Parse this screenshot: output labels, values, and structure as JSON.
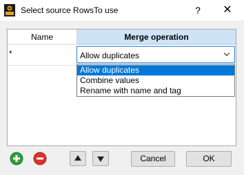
{
  "window": {
    "title": "Select source RowsTo use",
    "help_label": "?",
    "close_label": "✕"
  },
  "table": {
    "columns": [
      "Name",
      "Merge operation"
    ],
    "rows": [
      {
        "marker": "*",
        "merge_operation": "Allow duplicates"
      }
    ]
  },
  "dropdown": {
    "selected": "Allow duplicates",
    "options": [
      "Allow duplicates",
      "Combine values",
      "Rename with name and tag"
    ]
  },
  "toolbar": {
    "add_icon": "plus-circle-icon",
    "remove_icon": "minus-circle-icon",
    "up_icon": "triangle-up-icon",
    "down_icon": "triangle-down-icon"
  },
  "buttons": {
    "cancel": "Cancel",
    "ok": "OK"
  },
  "colors": {
    "header_selected": "#cde4f7",
    "selection": "#0078d7",
    "add": "#2e9e3e",
    "remove": "#d9342b"
  }
}
